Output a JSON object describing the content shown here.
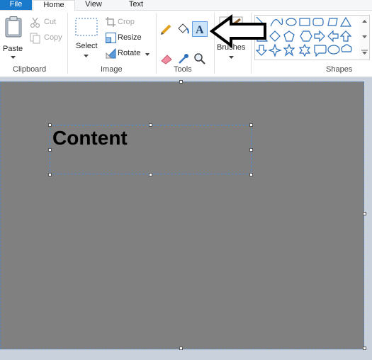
{
  "tabs": {
    "file": "File",
    "home": "Home",
    "view": "View",
    "text": "Text"
  },
  "clipboard": {
    "paste": "Paste",
    "cut": "Cut",
    "copy": "Copy",
    "group_label": "Clipboard"
  },
  "image": {
    "select": "Select",
    "crop": "Crop",
    "resize": "Resize",
    "rotate": "Rotate",
    "group_label": "Image"
  },
  "tools": {
    "group_label": "Tools",
    "items": [
      "pencil-icon",
      "fill-icon",
      "text-icon",
      "eraser-icon",
      "color-picker-icon",
      "magnifier-icon"
    ],
    "selected": "text-icon"
  },
  "brushes": {
    "label": "Brushes"
  },
  "shapes": {
    "group_label": "Shapes"
  },
  "canvas": {
    "text_content": "Content",
    "background": "#808080"
  },
  "colors": {
    "file_tab": "#1979ca",
    "selection_highlight": "#cce4f7",
    "canvas_bg": "#808080"
  }
}
